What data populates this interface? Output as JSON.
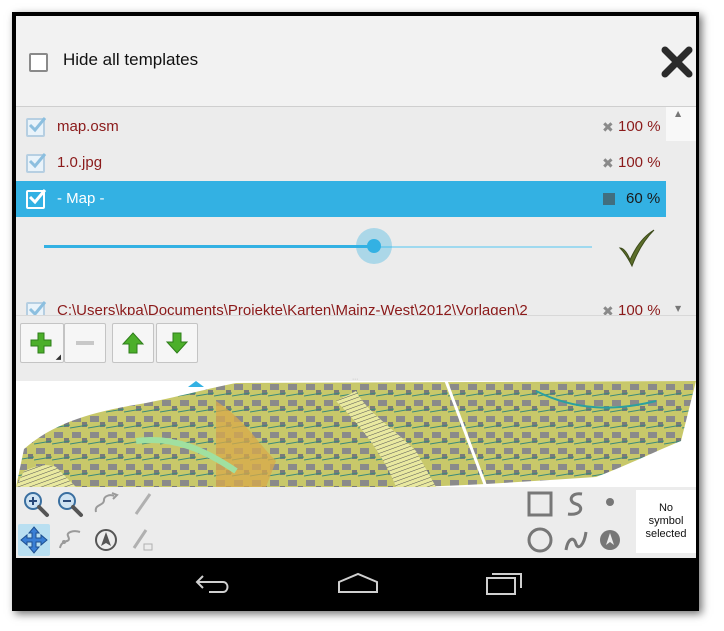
{
  "header": {
    "hide_all_label": "Hide all templates",
    "hide_all_checked": false
  },
  "templates": [
    {
      "name": "map.osm",
      "opacity": "100 %",
      "visible": true
    },
    {
      "name": "1.0.jpg",
      "opacity": "100 %",
      "visible": true
    },
    {
      "name": "- Map -",
      "opacity": "60 %",
      "visible": true,
      "selected": true
    },
    {
      "name": "C:\\Users\\kpa\\Documents\\Projekte\\Karten\\Mainz-West\\2012\\Vorlagen\\2",
      "opacity": "100 %",
      "visible": true
    }
  ],
  "opacity_slider": {
    "value": 0.6
  },
  "toolbar": {
    "icons": [
      "add-icon",
      "remove-icon",
      "move-up-icon",
      "move-down-icon"
    ]
  },
  "symbol": {
    "label": "No\nsymbol\nselected"
  },
  "colors": {
    "accent": "#33b1e3",
    "template_text": "#8b1a1a",
    "green": "#4caf2a"
  },
  "nav": {
    "icons": [
      "back-icon",
      "home-icon",
      "recents-icon"
    ]
  }
}
